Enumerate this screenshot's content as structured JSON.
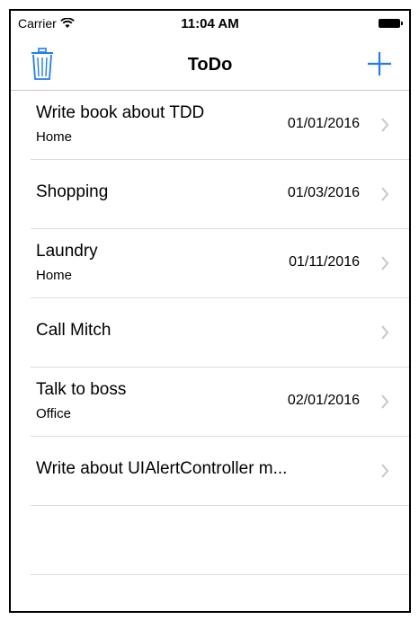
{
  "status": {
    "carrier": "Carrier",
    "time": "11:04 AM"
  },
  "nav": {
    "title": "ToDo"
  },
  "colors": {
    "accent": "#1f7cf6",
    "separator": "#dcdcdc",
    "chevron": "#c7c7cc"
  },
  "items": [
    {
      "title": "Write book about TDD",
      "subtitle": "Home",
      "date": "01/01/2016"
    },
    {
      "title": "Shopping",
      "subtitle": "",
      "date": "01/03/2016"
    },
    {
      "title": "Laundry",
      "subtitle": "Home",
      "date": "01/11/2016"
    },
    {
      "title": "Call Mitch",
      "subtitle": "",
      "date": ""
    },
    {
      "title": "Talk to boss",
      "subtitle": "Office",
      "date": "02/01/2016"
    },
    {
      "title": "Write about UIAlertController m...",
      "subtitle": "",
      "date": ""
    }
  ]
}
